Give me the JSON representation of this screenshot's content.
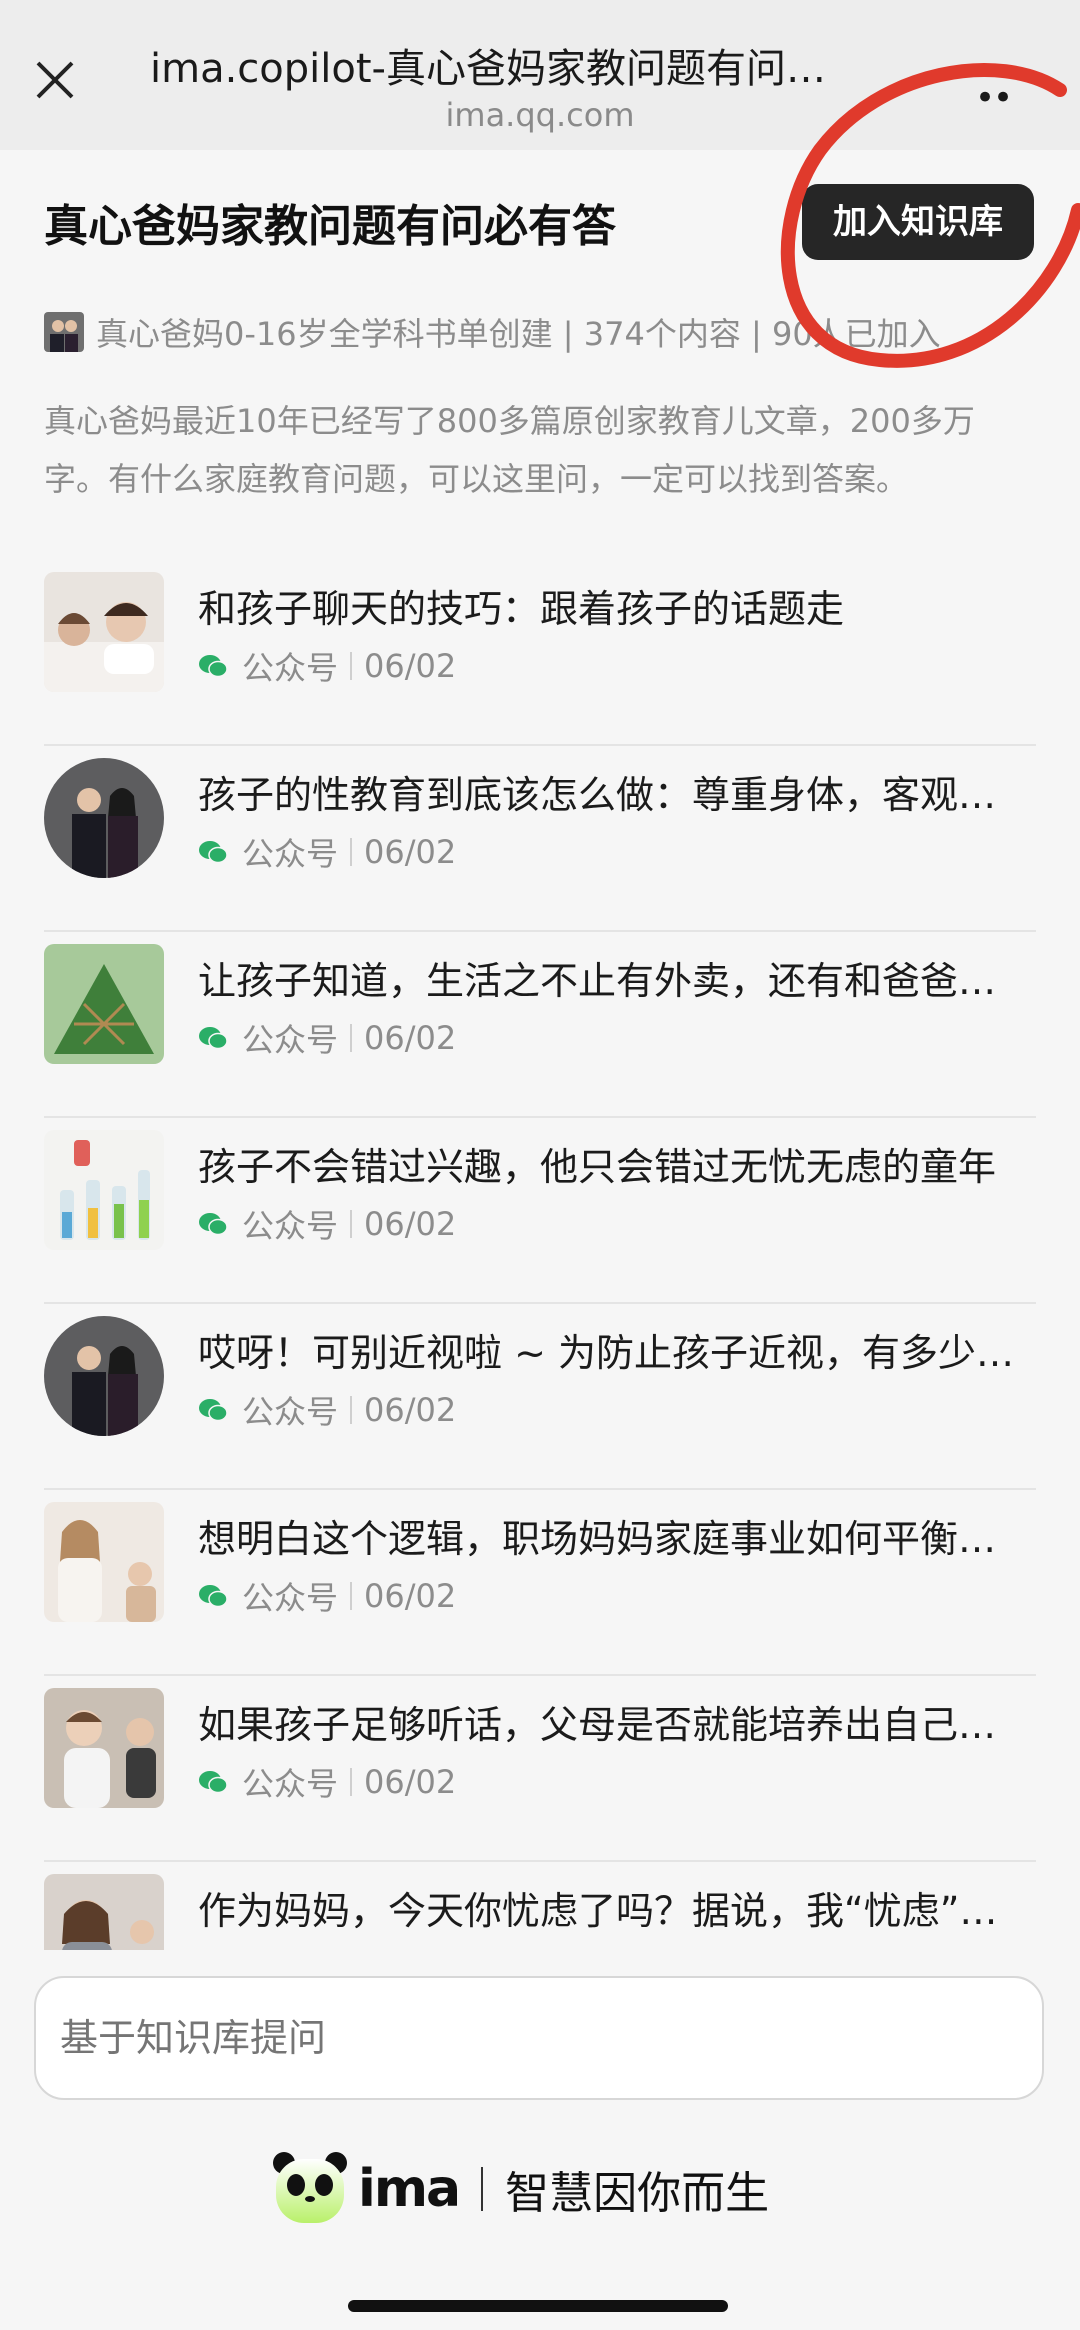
{
  "browser": {
    "title": "ima.copilot-真心爸妈家教问题有问…",
    "url": "ima.qq.com",
    "close_icon": "close-icon",
    "more_icon": "more-icon"
  },
  "knowledge_base": {
    "title": "真心爸妈家教问题有问必有答",
    "join_label": "加入知识库",
    "creator_line": "真心爸妈0-16岁全学科书单创建 | 374个内容 | 90人已加入",
    "description": "真心爸妈最近10年已经写了800多篇原创家教育儿文章，200多万字。有什么家庭教育问题，可以这里问，一定可以找到答案。"
  },
  "articles": [
    {
      "title": "和孩子聊天的技巧：跟着孩子的话题走",
      "source": "公众号",
      "date": "06/02",
      "thumb": "mother-child"
    },
    {
      "title": "孩子的性教育到底该怎么做：尊重身体，客观…",
      "source": "公众号",
      "date": "06/02",
      "thumb": "couple"
    },
    {
      "title": "让孩子知道，生活之不止有外卖，还有和爸爸…",
      "source": "公众号",
      "date": "06/02",
      "thumb": "zongzi"
    },
    {
      "title": "孩子不会错过兴趣，他只会错过无忧无虑的童年",
      "source": "公众号",
      "date": "06/02",
      "thumb": "lab"
    },
    {
      "title": "哎呀！可别近视啦 ~ 为防止孩子近视，有多少…",
      "source": "公众号",
      "date": "06/02",
      "thumb": "couple"
    },
    {
      "title": "想明白这个逻辑，职场妈妈家庭事业如何平衡…",
      "source": "公众号",
      "date": "06/02",
      "thumb": "working-mom"
    },
    {
      "title": "如果孩子足够听话，父母是否就能培养出自己…",
      "source": "公众号",
      "date": "06/02",
      "thumb": "kids"
    },
    {
      "title": "作为妈妈，今天你忧虑了吗？据说，我“忧虑”…",
      "source": "公众号",
      "date": "06/02",
      "thumb": "worried-mom"
    }
  ],
  "ask": {
    "placeholder": "基于知识库提问"
  },
  "brand": {
    "logo_text": "ima",
    "slogan": "智慧因你而生"
  },
  "colors": {
    "accent_dark": "#262626",
    "wechat_green": "#2aae67",
    "annotation_red": "#e03a2c"
  }
}
